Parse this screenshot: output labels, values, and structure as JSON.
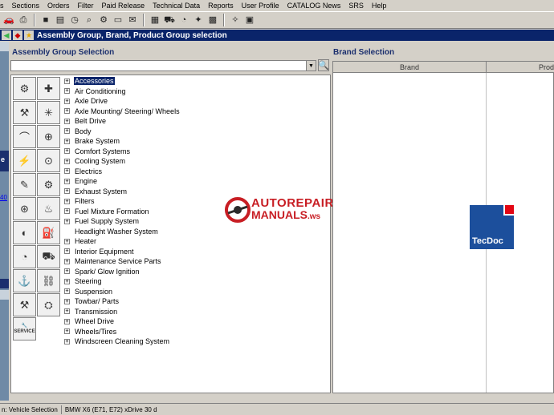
{
  "menu": [
    "s",
    "Sections",
    "Orders",
    "Filter",
    "Paid Release",
    "Technical Data",
    "Reports",
    "User Profile",
    "CATALOG News",
    "SRS",
    "Help"
  ],
  "toolbar_icons": [
    "car-icon",
    "printer-icon",
    "separator",
    "stop-icon",
    "document-icon",
    "clock-icon",
    "search-doc-icon",
    "gear-icon",
    "card-icon",
    "mail-icon",
    "separator",
    "chart-icon",
    "truck-icon",
    "pie-icon",
    "spark-icon",
    "grid-icon",
    "separator",
    "star-icon",
    "new-icon"
  ],
  "title_bar": {
    "title": "Assembly Group, Brand, Product Group selection"
  },
  "left_strip": {
    "label_e": "e",
    "link_40": "40"
  },
  "assembly": {
    "title": "Assembly Group Selection",
    "select_value": "",
    "items": [
      "Accessories",
      "Air Conditioning",
      "Axle Drive",
      "Axle Mounting/ Steering/ Wheels",
      "Belt Drive",
      "Body",
      "Brake System",
      "Comfort Systems",
      "Cooling System",
      "Electrics",
      "Engine",
      "Exhaust System",
      "Filters",
      "Fuel Mixture Formation",
      "Fuel Supply System",
      "Headlight Washer System",
      "Heater",
      "Interior Equipment",
      "Maintenance Service Parts",
      "Spark/ Glow Ignition",
      "Steering",
      "Suspension",
      "Towbar/ Parts",
      "Transmission",
      "Wheel Drive",
      "Wheels/Tires",
      "Windscreen Cleaning System"
    ],
    "no_expander": [
      "Headlight Washer System"
    ],
    "selected": "Accessories",
    "service_label": "SERVICE"
  },
  "brand": {
    "title": "Brand Selection",
    "columns": [
      "Brand",
      "Prod"
    ]
  },
  "watermark": {
    "line1": "AUTOREPAIR",
    "line2": "MANUALS",
    "tld": ".ws"
  },
  "tecdoc": {
    "label": "TecDoc"
  },
  "status": {
    "part1": "n: Vehicle Selection",
    "part2": "BMW X6 (E71, E72) xDrive 30 d"
  }
}
